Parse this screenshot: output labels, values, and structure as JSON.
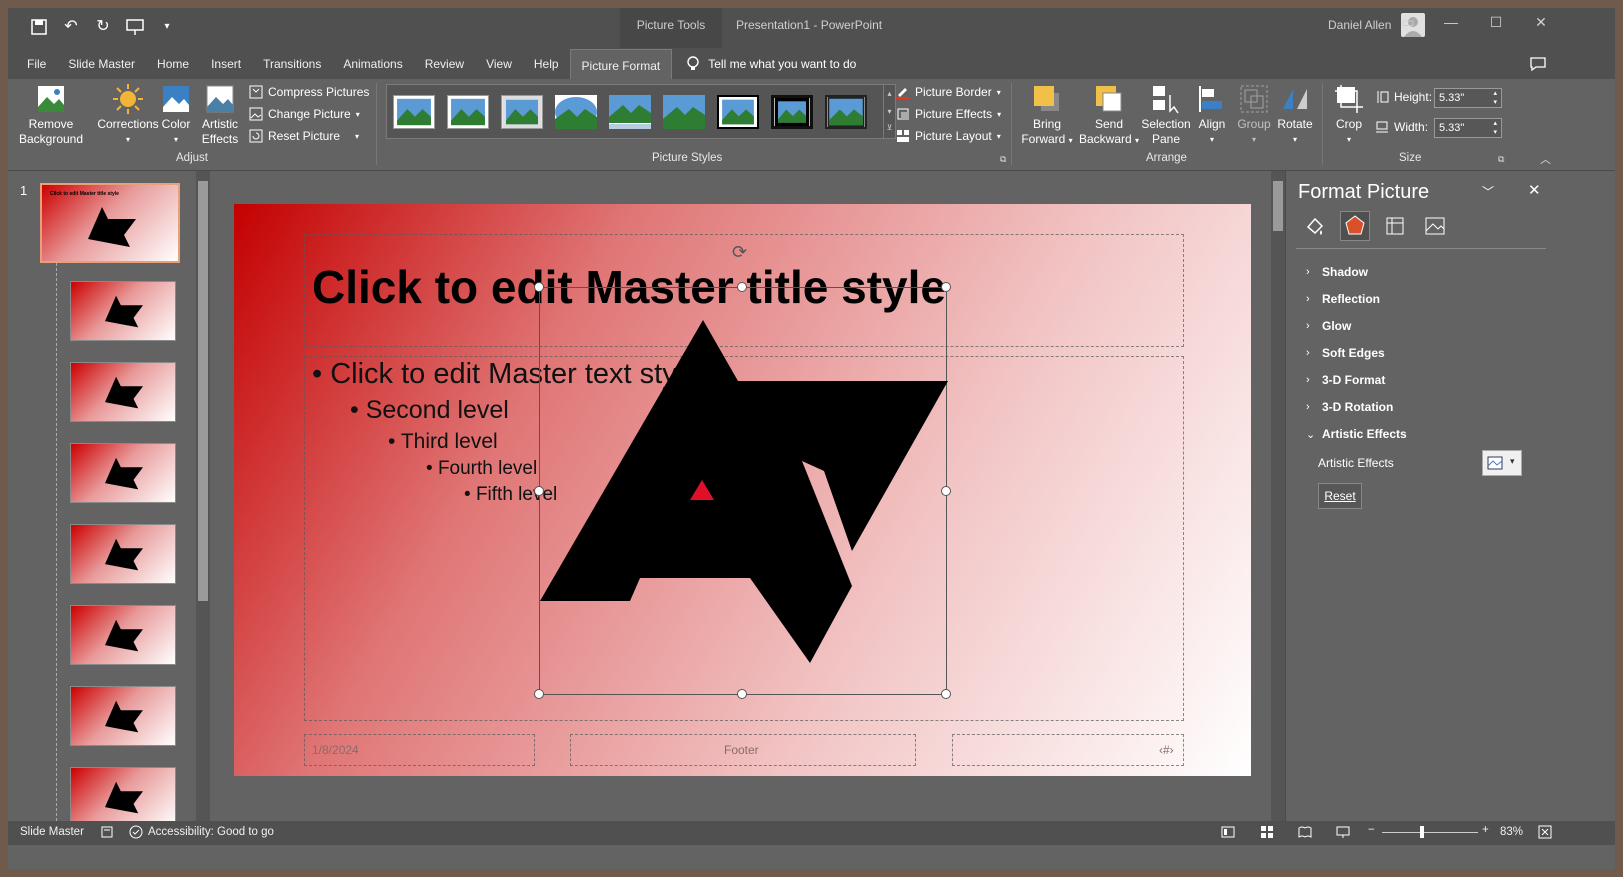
{
  "titlebar": {
    "context_tab": "Picture Tools",
    "document_title": "Presentation1  -  PowerPoint",
    "user_name": "Daniel Allen"
  },
  "menu": {
    "tabs": [
      "File",
      "Slide Master",
      "Home",
      "Insert",
      "Transitions",
      "Animations",
      "Review",
      "View",
      "Help",
      "Picture Format"
    ],
    "active_tab": "Picture Format",
    "tell_me": "Tell me what you want to do"
  },
  "ribbon": {
    "adjust": {
      "remove_background": [
        "Remove",
        "Background"
      ],
      "corrections": "Corrections",
      "color": "Color",
      "artistic_effects": [
        "Artistic",
        "Effects"
      ],
      "compress_pictures": "Compress Pictures",
      "change_picture": "Change Picture",
      "reset_picture": "Reset Picture",
      "label": "Adjust"
    },
    "picture_styles": {
      "picture_border": "Picture Border",
      "picture_effects": "Picture Effects",
      "picture_layout": "Picture Layout",
      "label": "Picture Styles"
    },
    "arrange": {
      "bring_forward": [
        "Bring",
        "Forward"
      ],
      "send_backward": [
        "Send",
        "Backward"
      ],
      "selection_pane": [
        "Selection",
        "Pane"
      ],
      "align": "Align",
      "group": "Group",
      "rotate": "Rotate",
      "label": "Arrange"
    },
    "size": {
      "crop": "Crop",
      "height_label": "Height:",
      "height_value": "5.33\"",
      "width_label": "Width:",
      "width_value": "5.33\"",
      "label": "Size"
    }
  },
  "thumbnails": {
    "slide_number": "1",
    "master_title": "Click to edit Master title style"
  },
  "slide": {
    "title": "Click to edit Master title style",
    "bullets": [
      "Click to edit Master text styles",
      "Second level",
      "Third level",
      "Fourth level",
      "Fifth level"
    ],
    "footer_date": "1/8/2024",
    "footer_text": "Footer",
    "footer_number": "‹#›"
  },
  "format_panel": {
    "title": "Format Picture",
    "sections": [
      "Shadow",
      "Reflection",
      "Glow",
      "Soft Edges",
      "3-D Format",
      "3-D Rotation",
      "Artistic Effects"
    ],
    "artistic_effects_label": "Artistic Effects",
    "reset_label": "Reset"
  },
  "status": {
    "view": "Slide Master",
    "accessibility": "Accessibility: Good to go",
    "zoom": "83%"
  },
  "colors": {
    "accent": "#c40000",
    "ribbon_bg": "#636363",
    "titlebar_bg": "#505050"
  }
}
